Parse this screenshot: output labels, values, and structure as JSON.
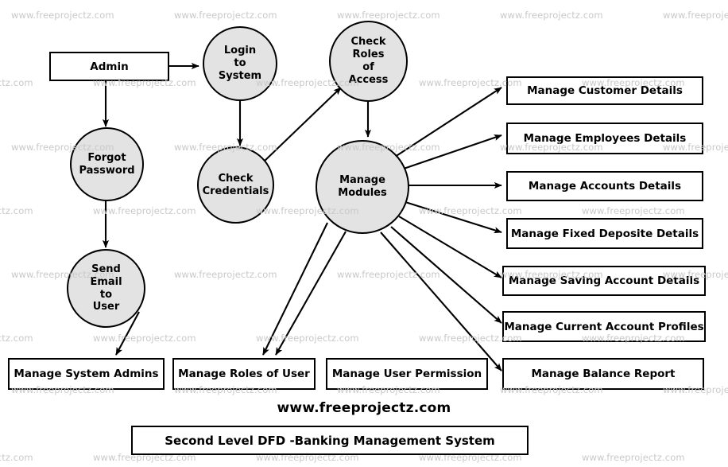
{
  "diagram": {
    "title": "Second Level DFD -Banking Management System",
    "footer_url": "www.freeprojectz.com",
    "watermark_text": "www.freeprojectz.com",
    "colors": {
      "process_fill": "#e3e3e3",
      "stroke": "#000000",
      "entity_fill": "#ffffff",
      "watermark": "#c9c9c9",
      "background": "#ffffff"
    }
  },
  "nodes": {
    "admin": {
      "label": "Admin",
      "type": "external-entity"
    },
    "login_to_system": {
      "label": "Login\nto\nSystem",
      "type": "process"
    },
    "check_roles_of_access": {
      "label": "Check\nRoles\nof\nAccess",
      "type": "process"
    },
    "forgot_password": {
      "label": "Forgot\nPassword",
      "type": "process"
    },
    "check_credentials": {
      "label": "Check\nCredentials",
      "type": "process"
    },
    "manage_modules": {
      "label": "Manage\nModules",
      "type": "process"
    },
    "send_email_to_user": {
      "label": "Send\nEmail\nto\nUser",
      "type": "process"
    }
  },
  "right_boxes": [
    {
      "label": "Manage Customer Details"
    },
    {
      "label": "Manage Employees Details"
    },
    {
      "label": "Manage Accounts Details"
    },
    {
      "label": "Manage Fixed Deposite Details"
    },
    {
      "label": "Manage Saving Account Details"
    },
    {
      "label": "Manage Current Account Profiles"
    },
    {
      "label": "Manage Balance Report"
    }
  ],
  "bottom_boxes": [
    {
      "label": "Manage System Admins"
    },
    {
      "label": "Manage Roles of User"
    },
    {
      "label": "Manage User Permission"
    }
  ],
  "flows": [
    {
      "from": "Admin",
      "to": "Login to System"
    },
    {
      "from": "Admin",
      "to": "Forgot Password"
    },
    {
      "from": "Login to System",
      "to": "Check Credentials"
    },
    {
      "from": "Check Credentials",
      "to": "Check Roles of Access"
    },
    {
      "from": "Check Roles of Access",
      "to": "Manage Modules"
    },
    {
      "from": "Forgot Password",
      "to": "Send Email to User"
    },
    {
      "from": "Send Email to User",
      "to": "Manage System Admins"
    },
    {
      "from": "Manage Modules",
      "to": "Manage Customer Details"
    },
    {
      "from": "Manage Modules",
      "to": "Manage Employees Details"
    },
    {
      "from": "Manage Modules",
      "to": "Manage Accounts Details"
    },
    {
      "from": "Manage Modules",
      "to": "Manage Fixed Deposite Details"
    },
    {
      "from": "Manage Modules",
      "to": "Manage Saving Account Details"
    },
    {
      "from": "Manage Modules",
      "to": "Manage Current Account Profiles"
    },
    {
      "from": "Manage Modules",
      "to": "Manage Balance Report"
    },
    {
      "from": "Manage Modules",
      "to": "Manage Roles of User"
    },
    {
      "from": "Manage Modules",
      "to": "Manage User Permission"
    }
  ]
}
